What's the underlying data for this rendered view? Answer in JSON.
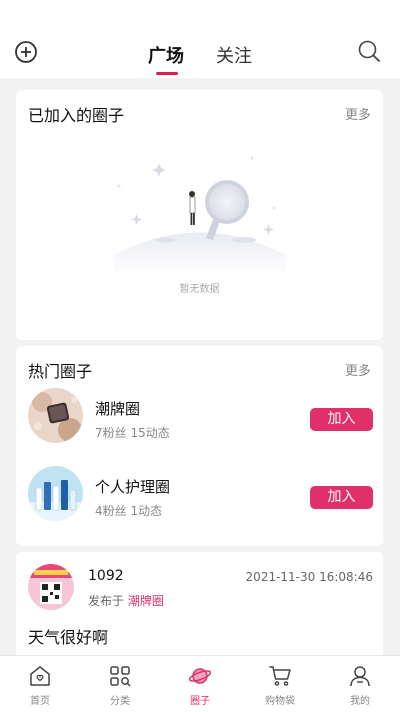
{
  "header": {
    "tabs": [
      {
        "label": "广场",
        "active": true
      },
      {
        "label": "关注",
        "active": false
      }
    ],
    "accent_color": "#e31c50"
  },
  "joined": {
    "title": "已加入的圈子",
    "more": "更多",
    "empty_text": "暂无数据"
  },
  "hot": {
    "title": "热门圈子",
    "more": "更多",
    "items": [
      {
        "name": "潮牌圈",
        "stats": "7粉丝 15动态",
        "join_label": "加入"
      },
      {
        "name": "个人护理圈",
        "stats": "4粉丝 1动态",
        "join_label": "加入"
      }
    ]
  },
  "post": {
    "user": "1092",
    "time": "2021-11-30 16:08:46",
    "from_prefix": "发布于 ",
    "from_circle": "潮牌圈",
    "text": "天气很好啊"
  },
  "tabbar": {
    "items": [
      {
        "label": "首页",
        "icon": "home-icon"
      },
      {
        "label": "分类",
        "icon": "category-icon"
      },
      {
        "label": "圈子",
        "icon": "planet-icon",
        "active": true
      },
      {
        "label": "购物袋",
        "icon": "cart-icon"
      },
      {
        "label": "我的",
        "icon": "user-icon"
      }
    ]
  }
}
